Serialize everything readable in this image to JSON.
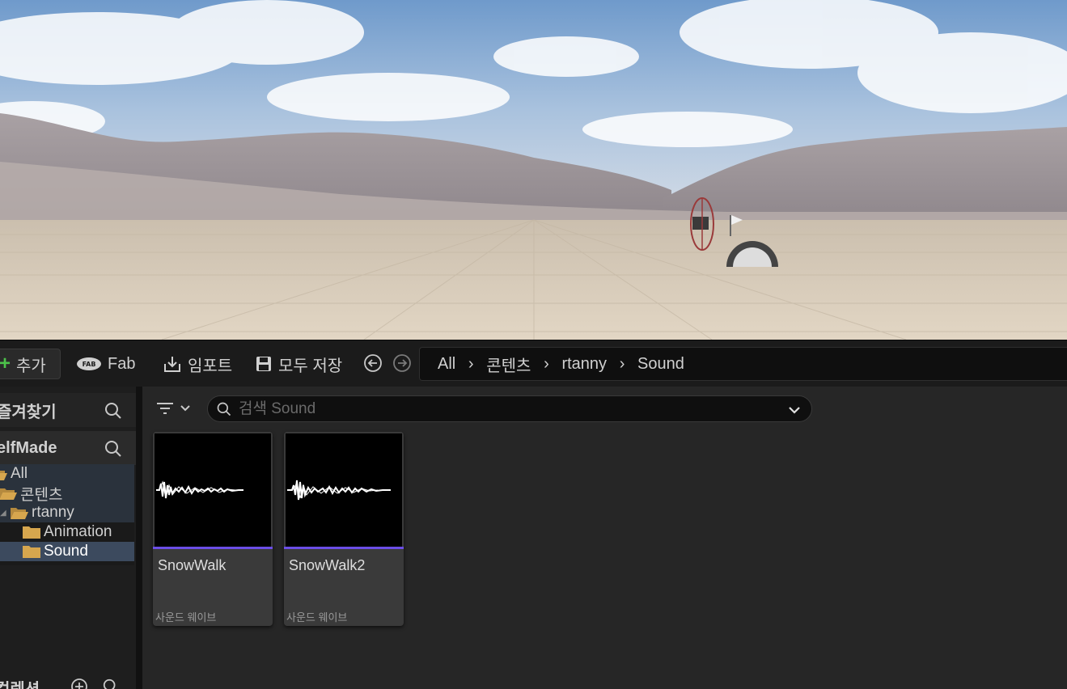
{
  "toolbar": {
    "add_label": "추가",
    "fab_label": "Fab",
    "import_label": "임포트",
    "save_all_label": "모두 저장"
  },
  "breadcrumb": [
    "All",
    "콘텐츠",
    "rtanny",
    "Sound"
  ],
  "left_panel": {
    "favorites_label": "즐겨찾기",
    "project_label": "elfMade",
    "tree": [
      {
        "label": "All"
      },
      {
        "label": "콘텐츠"
      },
      {
        "label": "rtanny"
      },
      {
        "label": "Animation"
      },
      {
        "label": "Sound"
      }
    ],
    "collections_label": "컬렉션"
  },
  "search": {
    "placeholder": "검색 Sound"
  },
  "assets": [
    {
      "name": "SnowWalk",
      "type": "사운드 웨이브"
    },
    {
      "name": "SnowWalk2",
      "type": "사운드 웨이브"
    }
  ],
  "colors": {
    "accent_sound": "#6b4ee6",
    "add_plus": "#4cc24a",
    "folder": "#d6a64e",
    "selected_row": "#3c4a5e"
  },
  "icons": [
    "plus-icon",
    "fab-icon",
    "import-icon",
    "save-icon",
    "back-arrow-icon",
    "forward-arrow-icon",
    "chevron-right-icon",
    "search-icon",
    "filter-icon",
    "chevron-down-icon",
    "folder-icon",
    "open-folder-icon",
    "waveform-icon"
  ]
}
